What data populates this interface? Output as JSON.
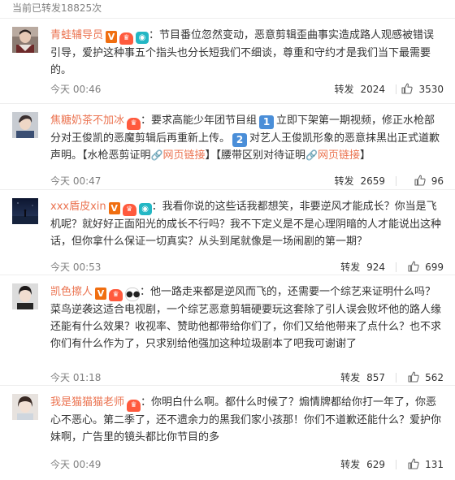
{
  "header": {
    "repost_count_text": "当前已转发18825次"
  },
  "labels": {
    "repost": "转发"
  },
  "colors": {
    "username": "#eb7350",
    "meta": "#808080",
    "verified_badge": "#f06e10",
    "level_badge": "#ff5a3d",
    "camera_badge": "#24b7c4",
    "number_badge": "#4a8ed8"
  },
  "comments": [
    {
      "username": "青蛙辅导员",
      "badges": [
        "verified-v-icon",
        "level-icon",
        "camera-icon"
      ],
      "text": "：节目番位忽然变动，恶意剪辑歪曲事实造成路人观感被错误引导，爱护这种事五个指头也分长短我们不细谈，尊重和守约才是我们当下最需要的。",
      "time": "今天 00:46",
      "reposts": "2024",
      "likes": "3530"
    },
    {
      "username": "焦糖奶茶不加冰",
      "badges": [
        "level-icon"
      ],
      "text_a": "：要求高能少年团节目组",
      "num1": "1",
      "text_b": "立即下架第一期视频，修正水枪部分对王俊凯的恶魔剪辑后再重新上传。",
      "num2": "2",
      "text_c": "对艺人王俊凯形象的恶意抹黑出正式道歉声明。【水枪恶剪证明",
      "link1": "网页链接",
      "text_d": "】【腰带区别对待证明",
      "link2": "网页链接",
      "text_e": "】",
      "time": "今天 00:47",
      "reposts": "2659",
      "likes": "96"
    },
    {
      "username": "xxx盾皮xin",
      "badges": [
        "verified-v-icon",
        "level-icon",
        "camera-icon"
      ],
      "text": "：我看你说的这些话我都想笑，非要逆风才能成长？你当是飞机呢？就好好正面阳光的成长不行吗？我不下定义是不是心理阴暗的人才能说出这种话，但你拿什么保证一切真实？从头到尾就像是一场闹剧的第一期？",
      "time": "今天 00:53",
      "reposts": "924",
      "likes": "699"
    },
    {
      "username": "凯色擦人",
      "badges": [
        "verified-v-icon",
        "level-icon",
        "panda-icon"
      ],
      "text": "：他一路走来都是逆风而飞的，还需要一个综艺来证明什么吗？菜鸟逆袭这适合电视剧，一个综艺恶意剪辑硬要玩这套除了引人误会败坏他的路人缘还能有什么效果？收视率、赞助他都带给你们了，你们又给他带来了点什么？也不求你们有什么作为了，只求别给他强加这种垃圾剧本了吧我可谢谢了",
      "time": "今天 01:18",
      "reposts": "857",
      "likes": "562"
    },
    {
      "username": "我是猫猫猫老师",
      "badges": [
        "level-icon"
      ],
      "text": "：你明白什么啊。都什么时候了？煽情牌都给你打一年了，你恶心不恶心。第二季了，还不遗余力的黑我们家小孩那！你们不道歉还能什么？爱护你妹啊，广告里的镜头都比你节目的多",
      "time": "今天 00:49",
      "reposts": "629",
      "likes": "131"
    }
  ]
}
